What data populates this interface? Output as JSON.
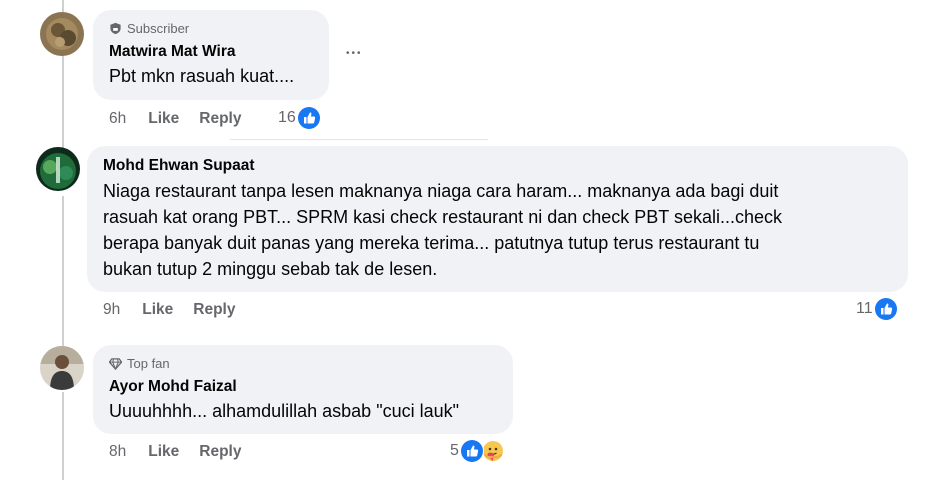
{
  "comments": [
    {
      "badge": "Subscriber",
      "author": "Matwira Mat Wira",
      "text": "Pbt mkn rasuah kuat....",
      "time": "6h",
      "like_label": "Like",
      "reply_label": "Reply",
      "reaction_count": "16",
      "reactions": [
        "like-icon"
      ],
      "more_label": "•••"
    },
    {
      "badge": "",
      "author": "Mohd Ehwan Supaat",
      "text_lines": [
        "Niaga restaurant tanpa lesen maknanya niaga cara haram... maknanya ada bagi duit",
        "rasuah kat orang PBT... SPRM kasi check restaurant ni dan check PBT sekali...check",
        "berapa banyak duit panas yang mereka terima... patutnya tutup terus restaurant tu",
        "bukan tutup 2 minggu sebab tak de lesen."
      ],
      "time": "9h",
      "like_label": "Like",
      "reply_label": "Reply",
      "reaction_count": "11",
      "reactions": [
        "like-icon"
      ]
    },
    {
      "badge": "Top fan",
      "author": "Ayor Mohd Faizal",
      "text": "Uuuuhhhh... alhamdulillah asbab \"cuci lauk\"",
      "time": "8h",
      "like_label": "Like",
      "reply_label": "Reply",
      "reaction_count": "5",
      "reactions": [
        "like-icon",
        "care-icon"
      ]
    }
  ],
  "colors": {
    "bubble": "#f0f2f5",
    "like_blue": "#1877f2",
    "meta_gray": "#65676b",
    "thread_line": "#ced0d4"
  }
}
